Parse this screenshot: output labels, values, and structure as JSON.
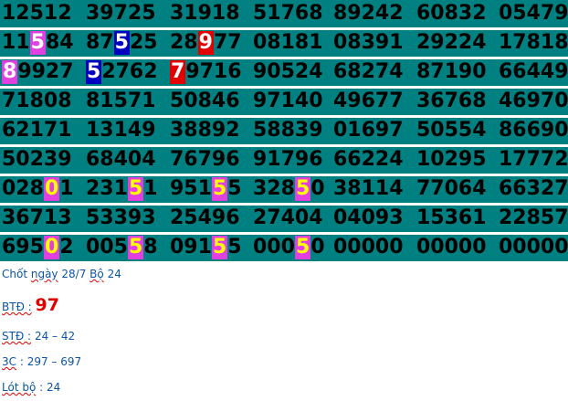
{
  "grid": {
    "rows": [
      [
        [
          {
            "t": "12512"
          }
        ],
        [
          {
            "t": "39725"
          }
        ],
        [
          {
            "t": "31918"
          }
        ],
        [
          {
            "t": "51768"
          }
        ],
        [
          {
            "t": "89242"
          }
        ],
        [
          {
            "t": "60832"
          }
        ],
        [
          {
            "t": "05479"
          }
        ]
      ],
      [
        [
          {
            "t": "11"
          },
          {
            "t": "5",
            "h": "mag"
          },
          {
            "t": "84"
          }
        ],
        [
          {
            "t": "87"
          },
          {
            "t": "5",
            "h": "blue"
          },
          {
            "t": "25"
          }
        ],
        [
          {
            "t": "28"
          },
          {
            "t": "9",
            "h": "red"
          },
          {
            "t": "77"
          }
        ],
        [
          {
            "t": "08181"
          }
        ],
        [
          {
            "t": "08391"
          }
        ],
        [
          {
            "t": "29224"
          }
        ],
        [
          {
            "t": "17818"
          }
        ]
      ],
      [
        [
          {
            "t": "8",
            "h": "mag"
          },
          {
            "t": "9927"
          }
        ],
        [
          {
            "t": "5",
            "h": "blue"
          },
          {
            "t": "2762"
          }
        ],
        [
          {
            "t": "7",
            "h": "red"
          },
          {
            "t": "9716"
          }
        ],
        [
          {
            "t": "90524"
          }
        ],
        [
          {
            "t": "68274"
          }
        ],
        [
          {
            "t": "87190"
          }
        ],
        [
          {
            "t": "66449"
          }
        ]
      ],
      [
        [
          {
            "t": "71808"
          }
        ],
        [
          {
            "t": "81571"
          }
        ],
        [
          {
            "t": "50846"
          }
        ],
        [
          {
            "t": "97140"
          }
        ],
        [
          {
            "t": "49677"
          }
        ],
        [
          {
            "t": "36768"
          }
        ],
        [
          {
            "t": "46970"
          }
        ]
      ],
      [
        [
          {
            "t": "62171"
          }
        ],
        [
          {
            "t": "13149"
          }
        ],
        [
          {
            "t": "38892"
          }
        ],
        [
          {
            "t": "58839"
          }
        ],
        [
          {
            "t": "01697"
          }
        ],
        [
          {
            "t": "50554"
          }
        ],
        [
          {
            "t": "86690"
          }
        ]
      ],
      [
        [
          {
            "t": "50239"
          }
        ],
        [
          {
            "t": "68404"
          }
        ],
        [
          {
            "t": "76796"
          }
        ],
        [
          {
            "t": "91796"
          }
        ],
        [
          {
            "t": "66224"
          }
        ],
        [
          {
            "t": "10295"
          }
        ],
        [
          {
            "t": "17772"
          }
        ]
      ],
      [
        [
          {
            "t": "028"
          },
          {
            "t": "0",
            "h": "magy"
          },
          {
            "t": "1"
          }
        ],
        [
          {
            "t": "231"
          },
          {
            "t": "5",
            "h": "magy"
          },
          {
            "t": "1"
          }
        ],
        [
          {
            "t": "951"
          },
          {
            "t": "5",
            "h": "magy"
          },
          {
            "t": "5"
          }
        ],
        [
          {
            "t": "328"
          },
          {
            "t": "5",
            "h": "magy"
          },
          {
            "t": "0"
          }
        ],
        [
          {
            "t": "38114"
          }
        ],
        [
          {
            "t": "77064"
          }
        ],
        [
          {
            "t": "66327"
          }
        ]
      ],
      [
        [
          {
            "t": "36713"
          }
        ],
        [
          {
            "t": "53393"
          }
        ],
        [
          {
            "t": "25496"
          }
        ],
        [
          {
            "t": "27404"
          }
        ],
        [
          {
            "t": "04093"
          }
        ],
        [
          {
            "t": "15361"
          }
        ],
        [
          {
            "t": "22857"
          }
        ]
      ],
      [
        [
          {
            "t": "695"
          },
          {
            "t": "0",
            "h": "magy"
          },
          {
            "t": "2"
          }
        ],
        [
          {
            "t": "005"
          },
          {
            "t": "5",
            "h": "magy"
          },
          {
            "t": "8"
          }
        ],
        [
          {
            "t": "091"
          },
          {
            "t": "5",
            "h": "magy"
          },
          {
            "t": "5"
          }
        ],
        [
          {
            "t": "000"
          },
          {
            "t": "5",
            "h": "magy"
          },
          {
            "t": "0"
          }
        ],
        [
          {
            "t": "00000"
          }
        ],
        [
          {
            "t": "00000"
          }
        ],
        [
          {
            "t": "00000"
          }
        ]
      ]
    ]
  },
  "notes": {
    "chot_a": "Chốt",
    "chot_b": "ngày",
    "chot_c": "28/7",
    "chot_d": "Bộ",
    "chot_e": "24",
    "btd_label": "BTĐ :",
    "btd_value": "97",
    "std_label": "STĐ :",
    "std_value": "24 – 42",
    "c3_label": "3C",
    "c3_value": ": 297  – 697",
    "lot_label": "Lót bộ",
    "lot_value": ": 24"
  },
  "colors": {
    "grid_bg": "#008080",
    "highlight_magenta": "#e040e0",
    "highlight_blue": "#0000c0",
    "highlight_red": "#e00000",
    "note_text": "#0b55a8",
    "btd_value": "#e00000"
  }
}
